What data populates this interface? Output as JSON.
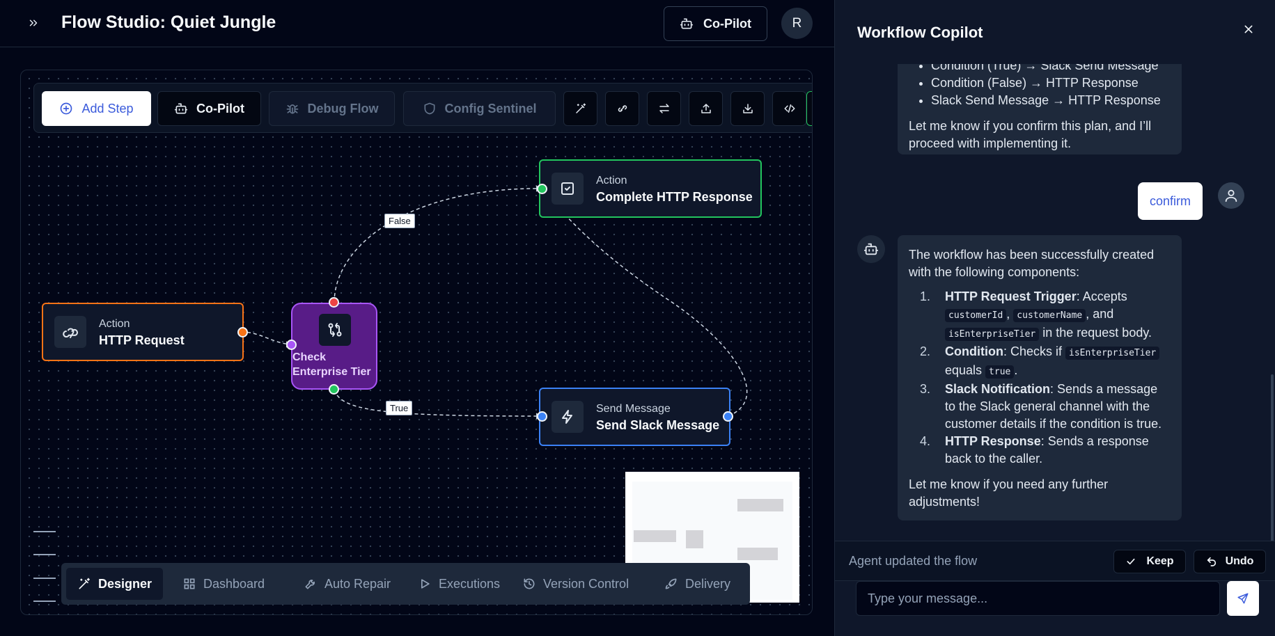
{
  "app": {
    "title": "Flow Studio: Quiet Jungle",
    "copilot_label": "Co-Pilot",
    "avatar_initial": "R"
  },
  "toolbar": {
    "add_step": "Add Step",
    "copilot": "Co-Pilot",
    "debug_flow": "Debug Flow",
    "config_sentinel": "Config Sentinel",
    "icons": [
      "magic-wand-icon",
      "ai-link-icon",
      "swap-icon",
      "upload-icon",
      "download-icon",
      "code-icon"
    ]
  },
  "nodes": {
    "http_request": {
      "subtitle": "Action",
      "title": "HTTP Request",
      "color": "#f97316"
    },
    "condition": {
      "title_line1": "Check",
      "title_line2": "Enterprise Tier",
      "color": "#a855f7"
    },
    "complete": {
      "subtitle": "Action",
      "title": "Complete HTTP Response",
      "color": "#22c55e"
    },
    "slack": {
      "subtitle": "Send Message",
      "title": "Send Slack Message",
      "color": "#3b82f6"
    }
  },
  "edges": {
    "false_label": "False",
    "true_label": "True"
  },
  "bottom_tabs": [
    {
      "label": "Designer",
      "icon": "magic-wand-icon",
      "active": true
    },
    {
      "label": "Dashboard",
      "icon": "dashboard-icon",
      "active": false
    },
    {
      "label": "Auto Repair",
      "icon": "wrench-icon",
      "active": false
    },
    {
      "label": "Executions",
      "icon": "play-icon",
      "active": false
    },
    {
      "label": "Version Control",
      "icon": "history-icon",
      "active": false
    },
    {
      "label": "Delivery",
      "icon": "rocket-icon",
      "active": false
    }
  ],
  "copilot_panel": {
    "title": "Workflow Copilot",
    "plan_items": [
      "Condition (True) → Slack Send Message",
      "Condition (False) → HTTP Response",
      "Slack Send Message → HTTP Response"
    ],
    "plan_confirm": "Let me know if you confirm this plan, and I’ll proceed with implementing it.",
    "user_message": "confirm",
    "result_intro": "The workflow has been successfully created with the following components:",
    "result_items": [
      {
        "num": "1.",
        "bold": "HTTP Request Trigger",
        "text": ": Accepts ",
        "codes": [
          "customerId",
          "customerName",
          "isEnterpriseTier"
        ],
        "sep1": ", ",
        "sep2": ", and ",
        "tail": " in the request body."
      },
      {
        "num": "2.",
        "bold": "Condition",
        "text": ": Checks if ",
        "code1": "isEnterpriseTier",
        "mid": " equals ",
        "code2": "true",
        "tail": "."
      },
      {
        "num": "3.",
        "bold": "Slack Notification",
        "text": ": Sends a message to the Slack general channel with the customer details if the condition is true."
      },
      {
        "num": "4.",
        "bold": "HTTP Response",
        "text": ": Sends a response back to the caller."
      }
    ],
    "result_end": "Let me know if you need any further adjustments!",
    "status": "Agent updated the flow",
    "keep": "Keep",
    "undo": "Undo",
    "input_placeholder": "Type your message..."
  }
}
